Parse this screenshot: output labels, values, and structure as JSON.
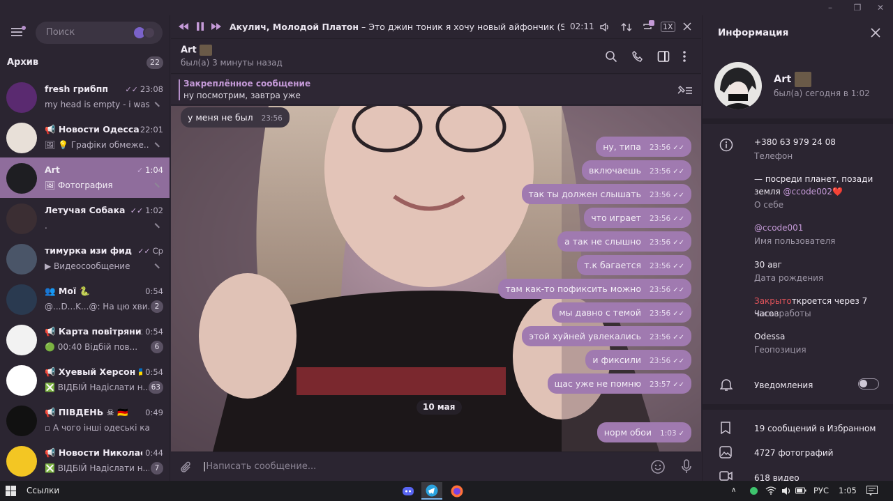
{
  "window": {
    "controls": [
      "–",
      "❐",
      "✕"
    ]
  },
  "sidebar": {
    "search_placeholder": "Поиск",
    "archive_title": "Архив",
    "archive_count": "22",
    "chats": [
      {
        "name": "fresh грибпп",
        "time": "23:08",
        "checks": "✓✓",
        "preview": "my head is empty - i was ...",
        "badge": "",
        "pinned": true,
        "avatar": "#5a2a70"
      },
      {
        "name": "📢 Новости Одесса | ...",
        "time": "22:01",
        "checks": "",
        "preview": "🖼 💡 Графіки обмеже...",
        "badge": "",
        "pinned": true,
        "avatar": "#e8e0d8"
      },
      {
        "name": "Art",
        "time": "1:04",
        "checks": "✓",
        "preview": "🖼 Фотография",
        "badge": "",
        "pinned": true,
        "avatar": "#1e1e22",
        "active": true
      },
      {
        "name": "Летучая Собака",
        "time": "1:02",
        "checks": "✓✓",
        "preview": ".",
        "badge": "",
        "pinned": true,
        "avatar": "#3b2e33"
      },
      {
        "name": "тимурка изи фид",
        "time": "Ср",
        "checks": "✓✓",
        "preview": "▶ Видеосообщение",
        "badge": "",
        "pinned": true,
        "avatar": "#4a5568"
      },
      {
        "name": "👥 Мої 🐍",
        "time": "0:54",
        "checks": "",
        "preview": "@...D...K...@: На цю хви...",
        "badge": "2",
        "pinned": false,
        "avatar": "#2a3a50"
      },
      {
        "name": "📢 Карта повітряних ...",
        "time": "0:54",
        "checks": "",
        "preview": "🟢 00:40 Відбій пов...",
        "badge": "6",
        "pinned": false,
        "avatar": "#f2f2f2"
      },
      {
        "name": "📢 Хуевый Херсон 🇺🇦",
        "time": "0:54",
        "checks": "",
        "preview": "❎ ВІДБІЙ  Надіслати н...",
        "badge": "63",
        "pinned": false,
        "avatar": "#ffffff"
      },
      {
        "name": "📢 ПІВДЕНЬ ☠ 🇩🇪",
        "time": "0:49",
        "checks": "",
        "preview": "▫ А чого інші одеські кана...",
        "badge": "",
        "pinned": false,
        "avatar": "#111111"
      },
      {
        "name": "📢 Новости Николае...",
        "time": "0:44",
        "checks": "",
        "preview": "❎ ВІДБІЙ  Надіслати н...",
        "badge": "7",
        "pinned": false,
        "avatar": "#f3c623"
      }
    ]
  },
  "player": {
    "artist": "Акулич, Молодой Платон",
    "title": " – Это джин тоник я хочу новый айфончик (Speed Up) (",
    "time": "02:11",
    "speed": "1X"
  },
  "chat": {
    "name": "Art",
    "status": "был(а) 3 минуты назад",
    "pinned_title": "Закреплённое сообщение",
    "pinned_text": "ну посмотрим, завтра уже",
    "date_divider": "10 мая",
    "messages": [
      {
        "dir": "in",
        "text": "у меня не был",
        "time": "23:56"
      },
      {
        "dir": "out",
        "text": "ну, типа",
        "time": "23:56"
      },
      {
        "dir": "out",
        "text": "включаешь",
        "time": "23:56"
      },
      {
        "dir": "out",
        "text": "так ты должен слышать",
        "time": "23:56"
      },
      {
        "dir": "out",
        "text": "что играет",
        "time": "23:56"
      },
      {
        "dir": "out",
        "text": "а так не слышно",
        "time": "23:56"
      },
      {
        "dir": "out",
        "text": "т.к багается",
        "time": "23:56"
      },
      {
        "dir": "out",
        "text": "там как-то пофиксить можно",
        "time": "23:56"
      },
      {
        "dir": "out",
        "text": "мы давно с темой",
        "time": "23:56"
      },
      {
        "dir": "out",
        "text": "этой хуйней увлекались",
        "time": "23:56"
      },
      {
        "dir": "out",
        "text": "и фиксили",
        "time": "23:56"
      },
      {
        "dir": "out",
        "text": "щас уже не помню",
        "time": "23:57"
      },
      {
        "dir": "out",
        "text": "норм обои",
        "time": "1:03"
      }
    ],
    "composer_placeholder": "Написать сообщение..."
  },
  "info": {
    "title": "Информация",
    "name": "Art",
    "status": "был(а) сегодня в 1:02",
    "phone": "+380 63 979 24 08",
    "phone_label": "Телефон",
    "bio_line1": "— посреди планет, позади",
    "bio_line2_prefix": "земля ",
    "bio_handle": "@ccode002",
    "bio_heart": "❤️",
    "bio_label": "О себе",
    "username": "@ccode001",
    "username_label": "Имя пользователя",
    "birthday": "30 авг",
    "birthday_label": "Дата рождения",
    "hours_closed": "Закрыто",
    "hours_rest": "ткроется через 7 часов",
    "hours_label": "Часы работы",
    "location": "Odessa",
    "location_label": "Геопозиция",
    "notifications_label": "Уведомления",
    "saved": "19 сообщений в Избранном",
    "photos": "4727 фотографий",
    "videos": "618 видео"
  },
  "taskbar": {
    "links_label": "Ссылки",
    "lang": "РУС",
    "clock": "1:05"
  }
}
